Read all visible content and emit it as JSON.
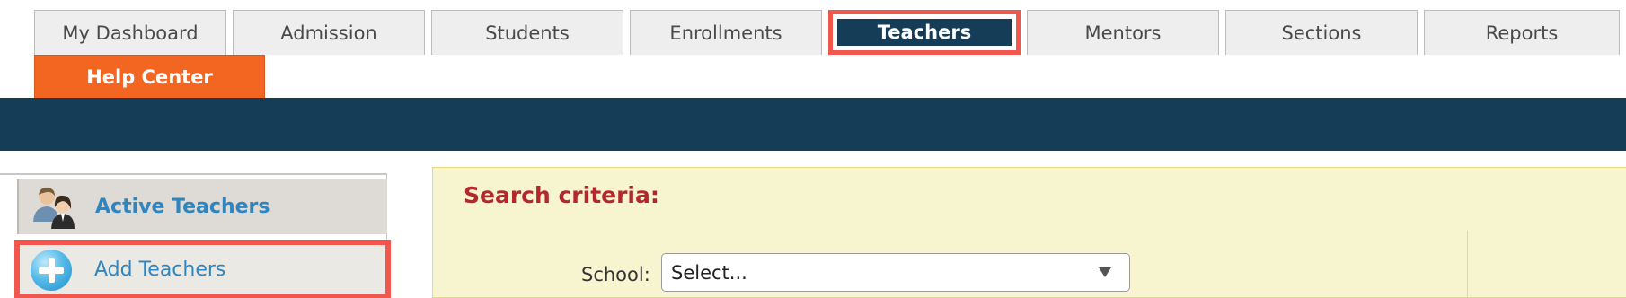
{
  "tabs": [
    {
      "label": "My Dashboard"
    },
    {
      "label": "Admission"
    },
    {
      "label": "Students"
    },
    {
      "label": "Enrollments"
    },
    {
      "label": "Teachers",
      "active": true
    },
    {
      "label": "Mentors"
    },
    {
      "label": "Sections"
    },
    {
      "label": "Reports"
    }
  ],
  "help_tab": {
    "label": "Help Center"
  },
  "sidebar": {
    "items": [
      {
        "label": "Active Teachers",
        "icon": "people-icon"
      },
      {
        "label": "Add Teachers",
        "icon": "plus-circle-icon"
      }
    ]
  },
  "search": {
    "title": "Search criteria:",
    "school_label": "School:",
    "school_value": "Select..."
  },
  "colors": {
    "nav_bar": "#163d57",
    "help_center": "#f26622",
    "highlight": "#f0584f",
    "search_panel_bg": "#f6f5cf",
    "search_title": "#b3282d",
    "sidebar_link": "#2f85c0"
  }
}
